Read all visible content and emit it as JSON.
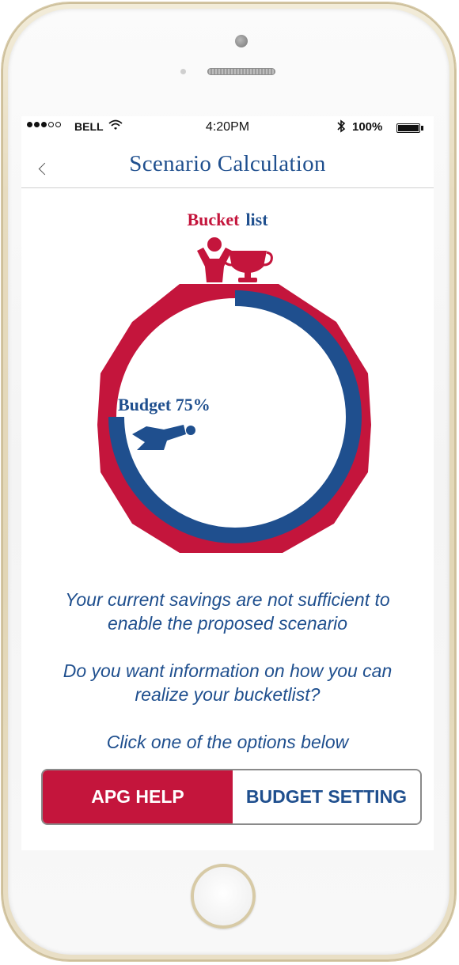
{
  "status_bar": {
    "carrier": "BELL",
    "time": "4:20PM",
    "battery": "100%",
    "signal_bars_filled": 3,
    "signal_bars_total": 5
  },
  "header": {
    "title": "Scenario Calculation",
    "back_icon": "chevron-left-icon"
  },
  "goal": {
    "word1": "Bucket",
    "word2": "list"
  },
  "progress": {
    "label": "Budget 75%",
    "fraction": 0.75
  },
  "messages": {
    "line1": "Your current savings are not sufficient to",
    "line2": "enable the proposed scenario",
    "line3": "Do you want information on how you can",
    "line4": "realize your bucketlist?",
    "line5": "Click one of the options below"
  },
  "options": {
    "help": "APG HELP",
    "budget": "BUDGET SETTING"
  },
  "colors": {
    "red": "#c4153c",
    "blue": "#1f4f8e"
  }
}
